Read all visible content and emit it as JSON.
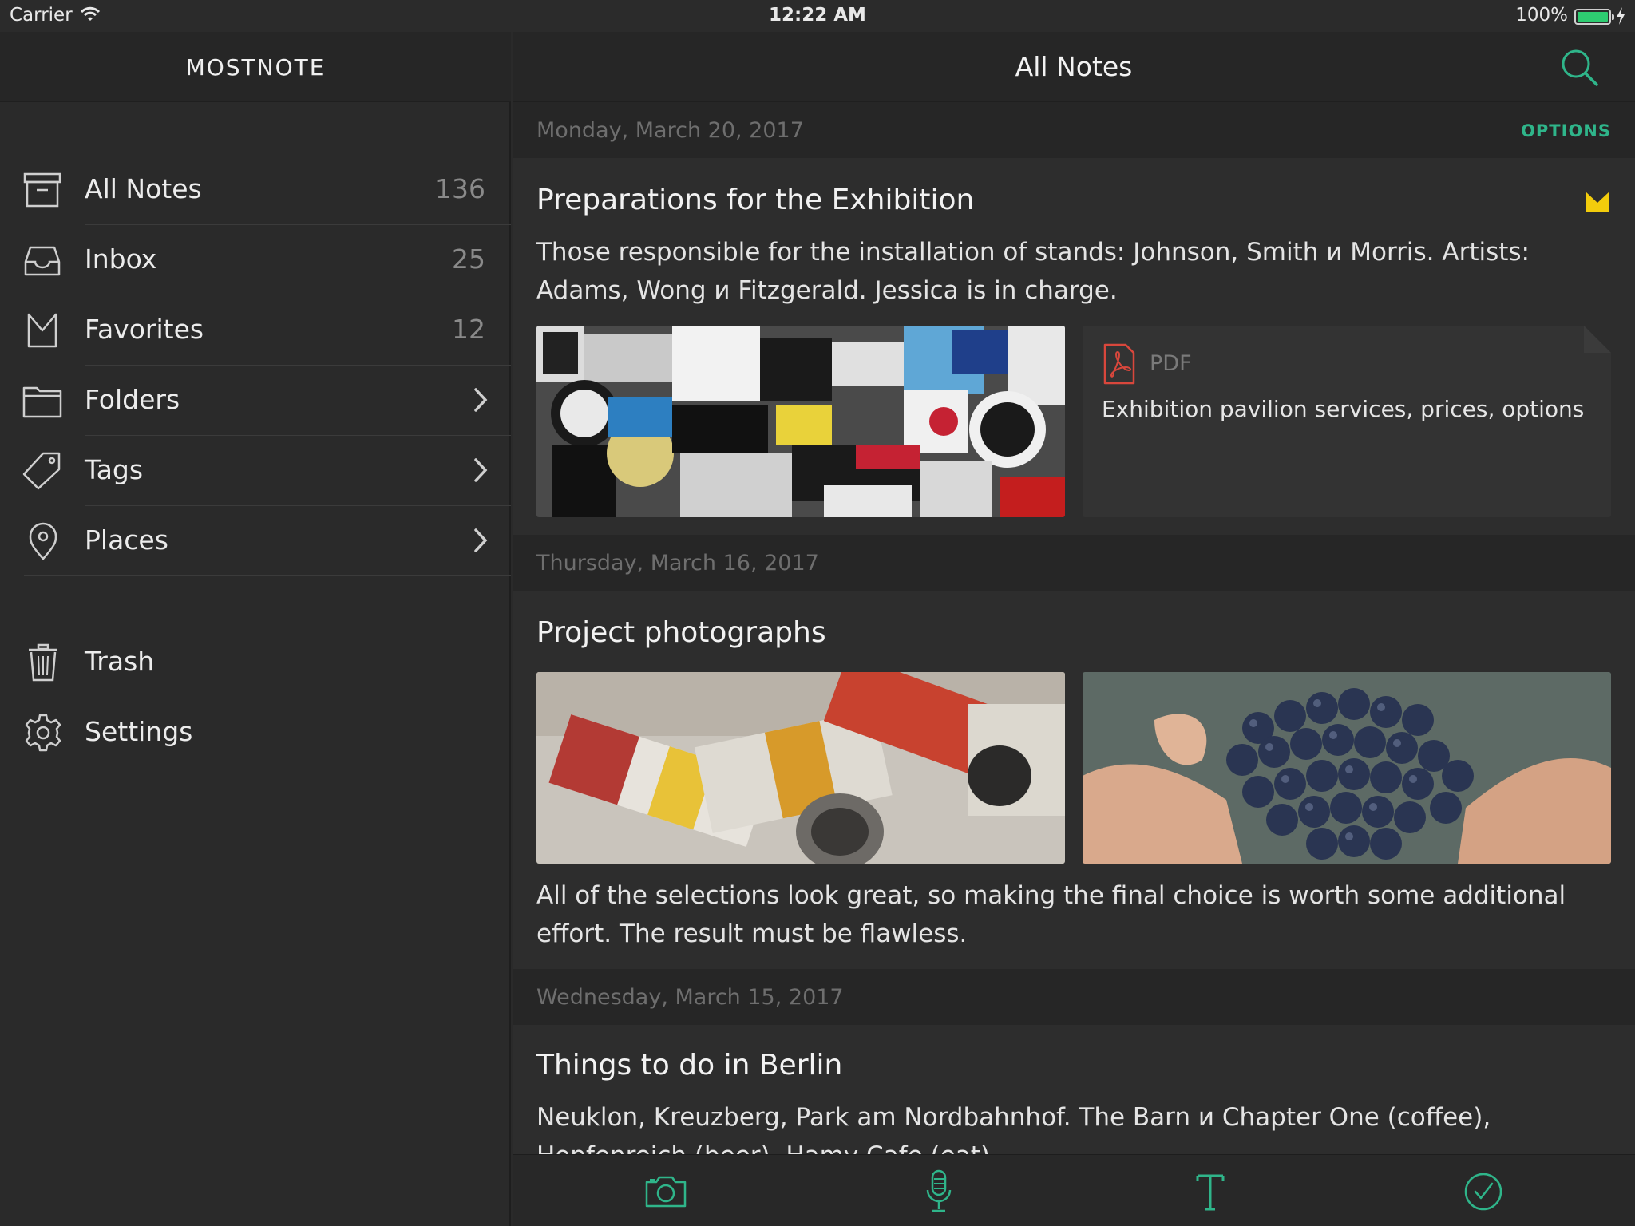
{
  "status_bar": {
    "carrier": "Carrier",
    "time": "12:22 AM",
    "battery": "100%"
  },
  "sidebar": {
    "title": "MOSTNOTE",
    "items": [
      {
        "label": "All Notes",
        "count": "136",
        "icon": "archive-box-icon"
      },
      {
        "label": "Inbox",
        "count": "25",
        "icon": "inbox-tray-icon"
      },
      {
        "label": "Favorites",
        "count": "12",
        "icon": "bookmark-icon"
      },
      {
        "label": "Folders",
        "icon": "folder-icon"
      },
      {
        "label": "Tags",
        "icon": "tag-icon"
      },
      {
        "label": "Places",
        "icon": "location-pin-icon"
      }
    ],
    "bottom_items": [
      {
        "label": "Trash",
        "icon": "trash-icon"
      },
      {
        "label": "Settings",
        "icon": "gear-icon"
      }
    ]
  },
  "main": {
    "title": "All Notes",
    "options_label": "OPTIONS",
    "groups": [
      {
        "date": "Monday, March 20, 2017",
        "note": {
          "title": "Preparations for the Exhibition",
          "body": "Those responsible for the installation of stands: Johnson, Smith и Morris. Artists: Adams, Wong и Fitzgerald. Jessica is in charge.",
          "attachment_type": "PDF",
          "attachment_title": "Exhibition pavilion services, prices, options",
          "favorite": true
        }
      },
      {
        "date": "Thursday, March 16, 2017",
        "note": {
          "title": "Project photographs",
          "body": "All of the selections look great, so making the final choice is worth some additional effort. The result must be flawless."
        }
      },
      {
        "date": "Wednesday, March 15, 2017",
        "note": {
          "title": "Things to do in Berlin",
          "body": "Neuklon, Kreuzberg, Park am Nordbahnhof. The Barn и Chapter One (coffee), Hopfenreich (beer), Hamy Cafe (eat)"
        }
      }
    ]
  },
  "toolbar": {
    "buttons": [
      "camera-icon",
      "microphone-icon",
      "text-icon",
      "checkmark-icon"
    ]
  },
  "colors": {
    "accent": "#2fb58a",
    "favorite": "#f2cc0c",
    "pdf": "#d9473c",
    "background": "#2d2d2d"
  }
}
